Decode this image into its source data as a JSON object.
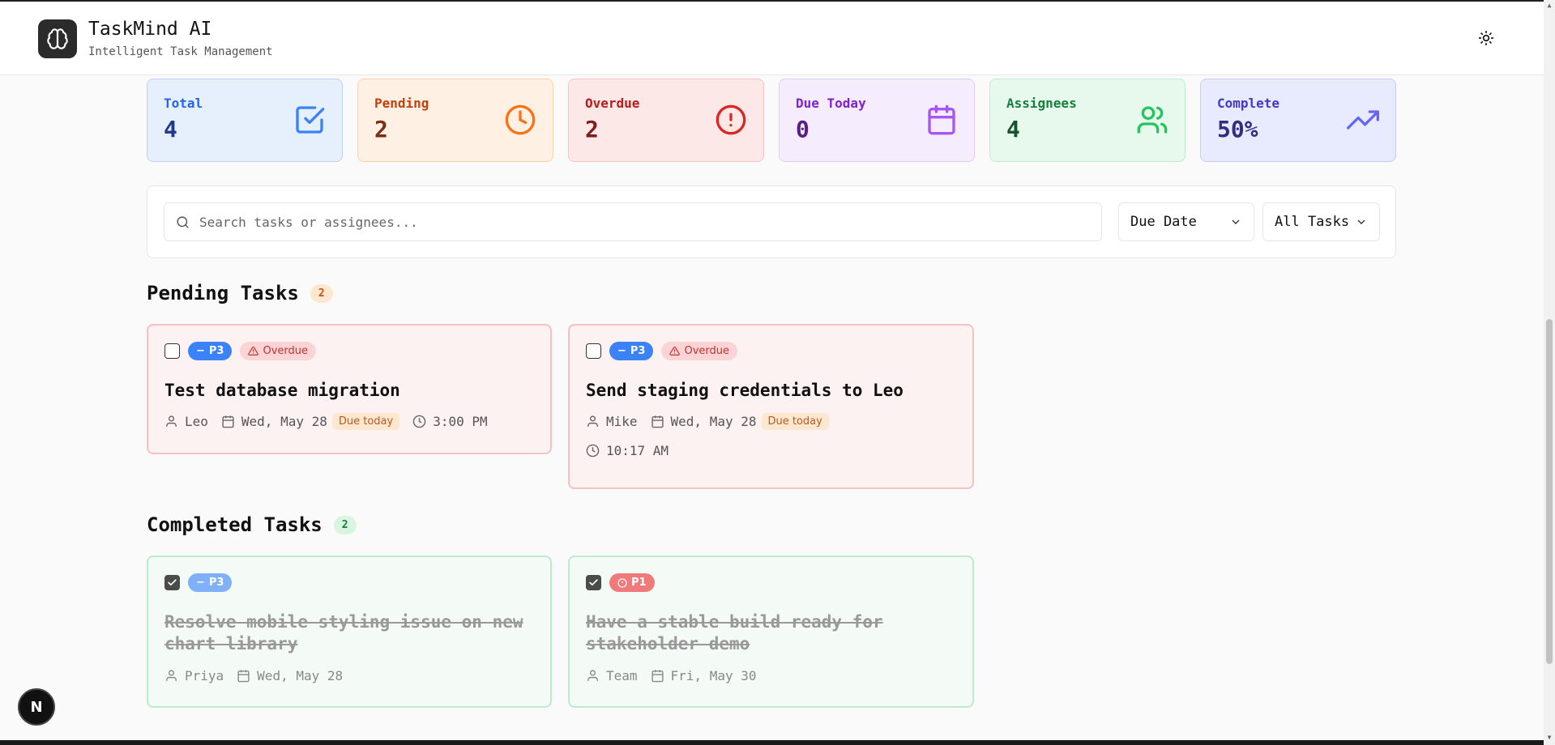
{
  "header": {
    "title": "TaskMind AI",
    "subtitle": "Intelligent Task Management"
  },
  "stats": [
    {
      "label": "Total",
      "value": "4",
      "icon": "check-square-icon",
      "color": "#2563eb"
    },
    {
      "label": "Pending",
      "value": "2",
      "icon": "clock-icon",
      "color": "#ea580c"
    },
    {
      "label": "Overdue",
      "value": "2",
      "icon": "alert-circle-icon",
      "color": "#dc2626"
    },
    {
      "label": "Due Today",
      "value": "0",
      "icon": "calendar-icon",
      "color": "#9333ea"
    },
    {
      "label": "Assignees",
      "value": "4",
      "icon": "users-icon",
      "color": "#16a34a"
    },
    {
      "label": "Complete",
      "value": "50%",
      "icon": "trending-up-icon",
      "color": "#4f46e5"
    }
  ],
  "filters": {
    "search_placeholder": "Search tasks or assignees...",
    "sort_value": "Due Date",
    "filter_value": "All Tasks"
  },
  "pending": {
    "title": "Pending Tasks",
    "count": "2",
    "tasks": [
      {
        "priority": "P3",
        "status": "Overdue",
        "title": "Test database migration",
        "assignee": "Leo",
        "date": "Wed, May 28",
        "due_label": "Due today",
        "time": "3:00 PM"
      },
      {
        "priority": "P3",
        "status": "Overdue",
        "title": "Send staging credentials to Leo",
        "assignee": "Mike",
        "date": "Wed, May 28",
        "due_label": "Due today",
        "time": "10:17 AM"
      }
    ]
  },
  "completed": {
    "title": "Completed Tasks",
    "count": "2",
    "tasks": [
      {
        "priority": "P3",
        "title": "Resolve mobile styling issue on new chart library",
        "assignee": "Priya",
        "date": "Wed, May 28"
      },
      {
        "priority": "P1",
        "title": "Have a stable build ready for stakeholder demo",
        "assignee": "Team",
        "date": "Fri, May 30"
      }
    ]
  },
  "fab_label": "N"
}
